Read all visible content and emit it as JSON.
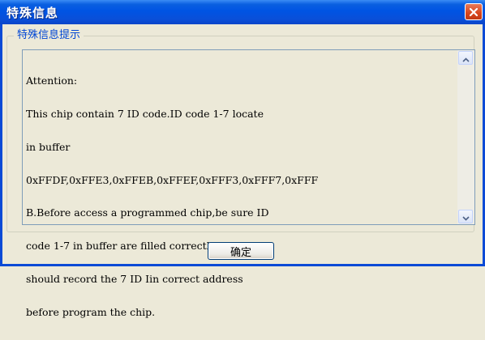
{
  "window": {
    "title": "特殊信息"
  },
  "group": {
    "legend": "特殊信息提示"
  },
  "message": {
    "lines": [
      "Attention:",
      "This chip contain 7 ID code.ID code 1-7 locate",
      "in buffer",
      "0xFFDF,0xFFE3,0xFFEB,0xFFEF,0xFFF3,0xFFF7,0xFFF",
      "B.Before access a programmed chip,be sure ID",
      "code 1-7 in buffer are filled correctly.You",
      "should record the 7 ID Iin correct address",
      "before program the chip."
    ]
  },
  "buttons": {
    "ok_label": "确定"
  },
  "icons": {
    "close": "close-icon",
    "scroll_up": "chevron-up-icon",
    "scroll_down": "chevron-down-icon"
  },
  "colors": {
    "titlebar": "#0054e3",
    "close": "#d8451c",
    "legend": "#0046d5",
    "dialog_bg": "#ece9d8"
  }
}
